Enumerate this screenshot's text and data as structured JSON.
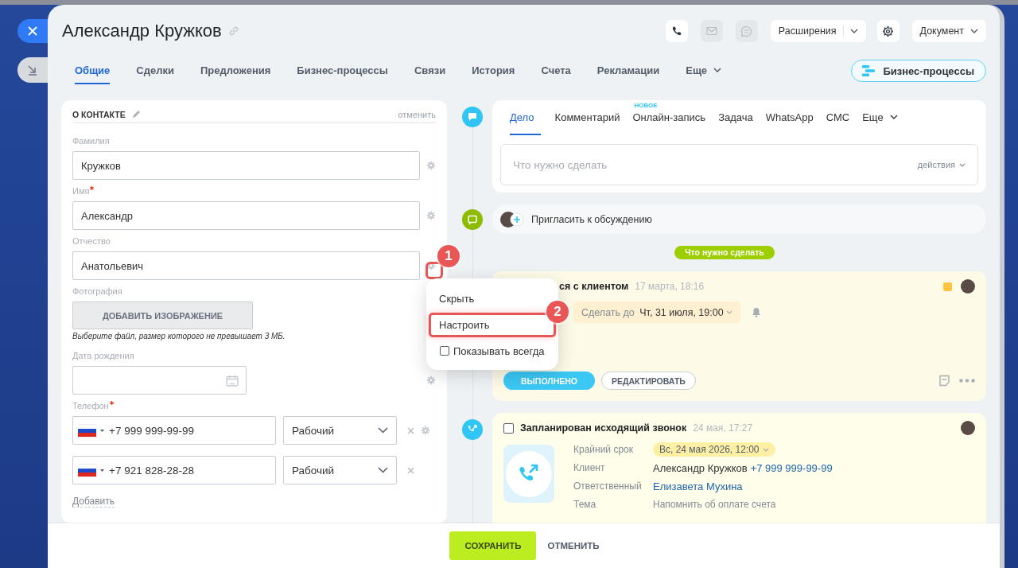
{
  "header": {
    "title": "Александр Кружков",
    "quick_actions": [
      {
        "kind": "call",
        "disabled": false
      },
      {
        "kind": "mail",
        "disabled": true
      },
      {
        "kind": "chat",
        "disabled": true
      }
    ],
    "extensions": "Расширения",
    "document": "Документ"
  },
  "tabs": [
    {
      "label": "Общие",
      "selected": true,
      "dropdown": false
    },
    {
      "label": "Сделки",
      "selected": false,
      "dropdown": false
    },
    {
      "label": "Предложения",
      "selected": false,
      "dropdown": false
    },
    {
      "label": "Бизнес-процессы",
      "selected": false,
      "dropdown": false
    },
    {
      "label": "Связи",
      "selected": false,
      "dropdown": false
    },
    {
      "label": "История",
      "selected": false,
      "dropdown": false
    },
    {
      "label": "Счета",
      "selected": false,
      "dropdown": false
    },
    {
      "label": "Рекламации",
      "selected": false,
      "dropdown": false
    },
    {
      "label": "Еще",
      "selected": false,
      "dropdown": true
    }
  ],
  "bp_button": "Бизнес-процессы",
  "contact": {
    "title": "О КОНТАКТЕ",
    "cancel": "отменить",
    "fields": [
      {
        "kind": "text",
        "label": "Фамилия",
        "required": false,
        "value": "Кружков",
        "gear": true
      },
      {
        "kind": "text",
        "label": "Имя",
        "required": true,
        "value": "Александр",
        "gear": true
      },
      {
        "kind": "text",
        "label": "Отчество",
        "required": false,
        "value": "Анатольевич",
        "gear": true
      },
      {
        "kind": "photo",
        "label": "Фотография",
        "button": "ДОБАВИТЬ ИЗОБРАЖЕНИЕ",
        "hint": "Выберите файл, размер которого не превышает 3 МБ."
      },
      {
        "kind": "date",
        "label": "Дата рождения",
        "required": false,
        "gear": true
      },
      {
        "kind": "phone",
        "label": "Телефон",
        "required": true,
        "phones": [
          {
            "number": "+7 999 999-99-99",
            "type": "Рабочий",
            "gear": true
          },
          {
            "number": "+7 921 828-28-28",
            "type": "Рабочий",
            "gear": false
          }
        ]
      }
    ],
    "add": "Добавить"
  },
  "context_menu": [
    {
      "kind": "action",
      "label": "Скрыть",
      "highlighted": false
    },
    {
      "kind": "action",
      "label": "Настроить",
      "highlighted": true
    },
    {
      "kind": "checkbox",
      "label": "Показывать всегда",
      "checked": false
    }
  ],
  "annotations": [
    "1",
    "2"
  ],
  "activity": {
    "tabs": [
      {
        "label": "Дело",
        "selected": true
      },
      {
        "label": "Комментарий",
        "selected": false
      },
      {
        "label": "Онлайн-запись",
        "selected": false,
        "badge": "НОВОЕ"
      },
      {
        "label": "Задача",
        "selected": false
      },
      {
        "label": "WhatsApp",
        "selected": false
      },
      {
        "label": "СМС",
        "selected": false
      }
    ],
    "more": "Еще",
    "placeholder": "Что нужно сделать",
    "actions": "действия"
  },
  "invite": "Пригласить к обсуждению",
  "section_label": "Что нужно сделать",
  "todo": {
    "title": "ся с клиентом",
    "time": "17 марта, 18:16",
    "deadline_label": "Сделать до",
    "deadline": "Чт, 31 июля, 19:00",
    "done": "ВЫПОЛНЕНО",
    "edit": "РЕДАКТИРОВАТЬ"
  },
  "call": {
    "checked": false,
    "title": "Запланирован исходящий звонок",
    "time": "24 мая, 17:27",
    "details": [
      {
        "kind": "chip",
        "label": "Крайний срок",
        "value": "Вс, 24 мая 2026, 12:00"
      },
      {
        "kind": "client",
        "label": "Клиент",
        "value": "Александр Кружков",
        "link": "+7 999 999-99-99"
      },
      {
        "kind": "link",
        "label": "Ответственный",
        "value": "Елизавета Мухина"
      },
      {
        "kind": "text",
        "label": "Тема",
        "value": "Напомнить об оплате счета"
      }
    ]
  },
  "footer": {
    "save": "СОХРАНИТЬ",
    "cancel": "ОТМЕНИТЬ"
  }
}
